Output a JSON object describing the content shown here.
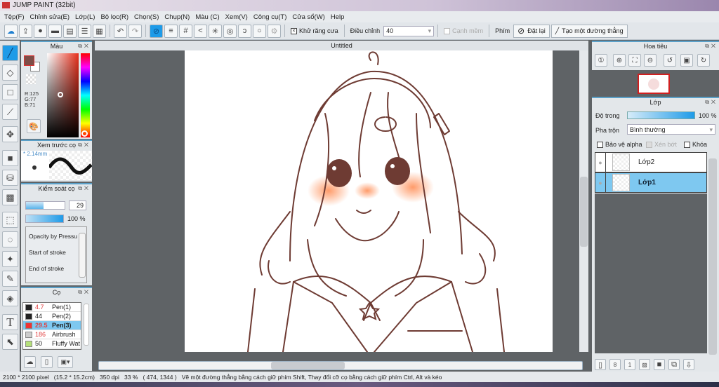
{
  "window": {
    "title": "JUMP PAINT (32bit)"
  },
  "menu": [
    "Tệp(F)",
    "Chỉnh sửa(E)",
    "Lớp(L)",
    "Bộ lọc(R)",
    "Chọn(S)",
    "Chụp(N)",
    "Màu (C)",
    "Xem(V)",
    "Công cụ(T)",
    "Cửa sổ(W)",
    "Help"
  ],
  "toolbar": {
    "antialias_label": "Khử răng cưa",
    "adjust_label": "Điều chỉnh",
    "adjust_value": "40",
    "soft_edge_label": "Cạnh mềm",
    "key_label": "Phím",
    "reset_label": "Đặt lại",
    "straight_line_label": "Tạo một đường thẳng"
  },
  "color_panel": {
    "title": "Màu",
    "r": "R:125",
    "g": "G:77",
    "b": "B:71",
    "foreground": "#7d4d47",
    "accent": "#1e9be8"
  },
  "brush_preview": {
    "title": "Xem trước cọ",
    "size": "* 2.14mm"
  },
  "brush_control": {
    "title": "Kiểm soát cọ",
    "size_value": "29",
    "size_fill": 0.45,
    "opacity_value": "100 %",
    "opacity_fill": 1.0,
    "options": [
      "Opacity by Pressu",
      "Start of stroke",
      "End of stroke"
    ]
  },
  "brush_list": {
    "title": "Cọ",
    "items": [
      {
        "size": "4.7",
        "name": "Pen(1)",
        "color": "#222222",
        "size_color": "#e04040"
      },
      {
        "size": "44",
        "name": "Pen(2)",
        "color": "#222222",
        "size_color": "#222222"
      },
      {
        "size": "29.5",
        "name": "Pen(3)",
        "color": "#ee3333",
        "size_color": "#e04040",
        "selected": true
      },
      {
        "size": "186",
        "name": "Airbrush",
        "color": "#cccccc",
        "size_color": "#e04040"
      },
      {
        "size": "50",
        "name": "Fluffy Wat",
        "color": "#b5e07a",
        "size_color": "#222222"
      }
    ]
  },
  "document": {
    "tab": "Untitled"
  },
  "navigator": {
    "title": "Hoa tiêu"
  },
  "layers": {
    "title": "Lớp",
    "opacity_label": "Độ trong",
    "opacity_value": "100 %",
    "blend_label": "Pha trộn",
    "blend_value": "Bình thường",
    "protect_alpha": "Bảo vệ alpha",
    "clip": "Xén bớt",
    "lock": "Khóa",
    "items": [
      {
        "name": "Lớp2",
        "selected": false
      },
      {
        "name": "Lớp1",
        "selected": true
      }
    ]
  },
  "status": {
    "size": "2100 * 2100 pixel",
    "cm": "(15.2 * 15.2cm)",
    "dpi": "350 dpi",
    "zoom": "33 %",
    "coords": "( 474, 1344 )",
    "hint": "Vẽ một đường thẳng bằng cách giữ phím Shift, Thay đổi cỡ cọ bằng cách giữ phím Ctrl, Alt và kéo"
  }
}
